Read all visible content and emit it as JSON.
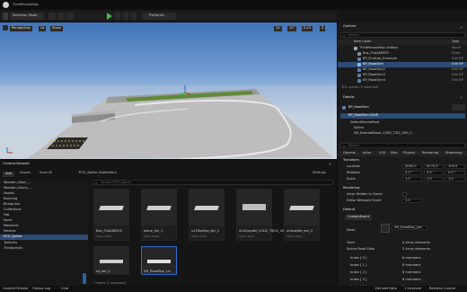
{
  "window": {
    "title": "ThirdPersonMap"
  },
  "toolbar": {
    "mode": "Selection Mode",
    "platforms": "Platforms"
  },
  "viewport": {
    "perspective": "Perspective",
    "lit": "Lit",
    "show": "Show",
    "grid_value": "10",
    "angle_value": "10°",
    "scale_value": "0.25",
    "speed_value": "4"
  },
  "outliner": {
    "tab": "Outliner",
    "search_placeholder": "Search...",
    "col_label": "Item Label",
    "col_type": "Type",
    "rows": [
      {
        "label": "ThirdPersonMap (Editor)",
        "type": "World"
      },
      {
        "label": "Box_F4A46EEE5",
        "type": "Static"
      },
      {
        "label": "BP_FirstLap_Example",
        "type": "Edit BP"
      },
      {
        "label": "BP_RoadGen",
        "type": "Edit BP"
      },
      {
        "label": "BP_RoadGen2",
        "type": "Edit BP"
      },
      {
        "label": "BP_RoadGen3",
        "type": "Edit BP"
      },
      {
        "label": "BP_RoadGen4",
        "type": "Edit BP"
      }
    ],
    "status": "101 actors (1 selected)"
  },
  "details": {
    "tab": "Details",
    "actor": "BP_RoadGen",
    "component_name": "BP_RoadGen (Self)",
    "components": [
      "DefaultSceneRoot",
      "Spline",
      "SM_BrembaRoad_LODS_TID2_000_0"
    ],
    "search_placeholder": "Search",
    "filters": [
      "General",
      "Actor",
      "LOD",
      "Misc",
      "Physics",
      "Rendering",
      "Streaming"
    ],
    "transform_label": "Transform",
    "location": {
      "label": "Location",
      "x": "2000.0",
      "y": "6270.0",
      "z": "100.0"
    },
    "rotation": {
      "label": "Rotation",
      "x": "0.0 °",
      "y": "0.0 °",
      "z": "0.0 °"
    },
    "scale": {
      "label": "Scale",
      "x": "1.0",
      "y": "1.0",
      "z": "1.0"
    },
    "rendering_label": "Rendering",
    "hidden_label": "Actor Hidden In Game",
    "billboard_label": "Editor Billboard Scale",
    "billboard_value": "1.0",
    "default_label": "Default",
    "custom_event": "CustomEvent",
    "mesh_label": "Mesh",
    "mesh_value": "SM_RoadBox_jion",
    "track_label": "Track",
    "track_value": "0 Array elements",
    "spline_label": "Spline Road Slots",
    "spline_value": "5 Array elements",
    "indices": [
      {
        "label": "Index [ 0 ]",
        "value": "8 members"
      },
      {
        "label": "Index [ 1 ]",
        "value": "8 members"
      },
      {
        "label": "Index [ 2 ]",
        "value": "8 members"
      },
      {
        "label": "Index [ 3 ]",
        "value": "8 members"
      },
      {
        "label": "Index [ 4 ]",
        "value": "8 members"
      }
    ]
  },
  "content_browser": {
    "tab": "Content Browser",
    "add": "Add",
    "import": "Import",
    "save_all": "Save All",
    "path": "PCG_Spline (Collection)",
    "settings": "Settings",
    "search_placeholder": "Search PCG_Spline",
    "status": "7 items (1 selected)",
    "folders": [
      "Wooden_Door_...",
      "Wooden_Doors_...",
      "Assets",
      "Blocking",
      "Blueprints",
      "Collections",
      "Fab",
      "Input",
      "Materials",
      "Meshes",
      "PCG_Spline",
      "Textures",
      "Thirdperson"
    ],
    "assets": [
      {
        "name": "Box_F4A46EEE5",
        "type": "Static Mesh"
      },
      {
        "name": "plane_ker_2",
        "type": "Static Mesh"
      },
      {
        "name": "u10Top5ga_ker_2",
        "type": "Static Mesh"
      },
      {
        "name": "u0dQzgv8e_LOD2_T0J02_2000",
        "type": "Static Mesh"
      },
      {
        "name": "u0sqdy8e_ker_2",
        "type": "Static Mesh"
      },
      {
        "name": "s4_ker_0",
        "type": "Static Mesh"
      },
      {
        "name": "SM_RoadBox_Liv",
        "type": "Static Mesh"
      }
    ]
  },
  "statusbar": {
    "drawer": "Content Drawer",
    "output": "Output Log",
    "cmd": "Cmd",
    "derived": "Derived Data",
    "unsaved": "1 Unsaved",
    "revision": "Revision Control"
  },
  "colors": {
    "accent": "#0070e0",
    "selected_row": "#2b4c74",
    "play": "#3fbf3f"
  }
}
